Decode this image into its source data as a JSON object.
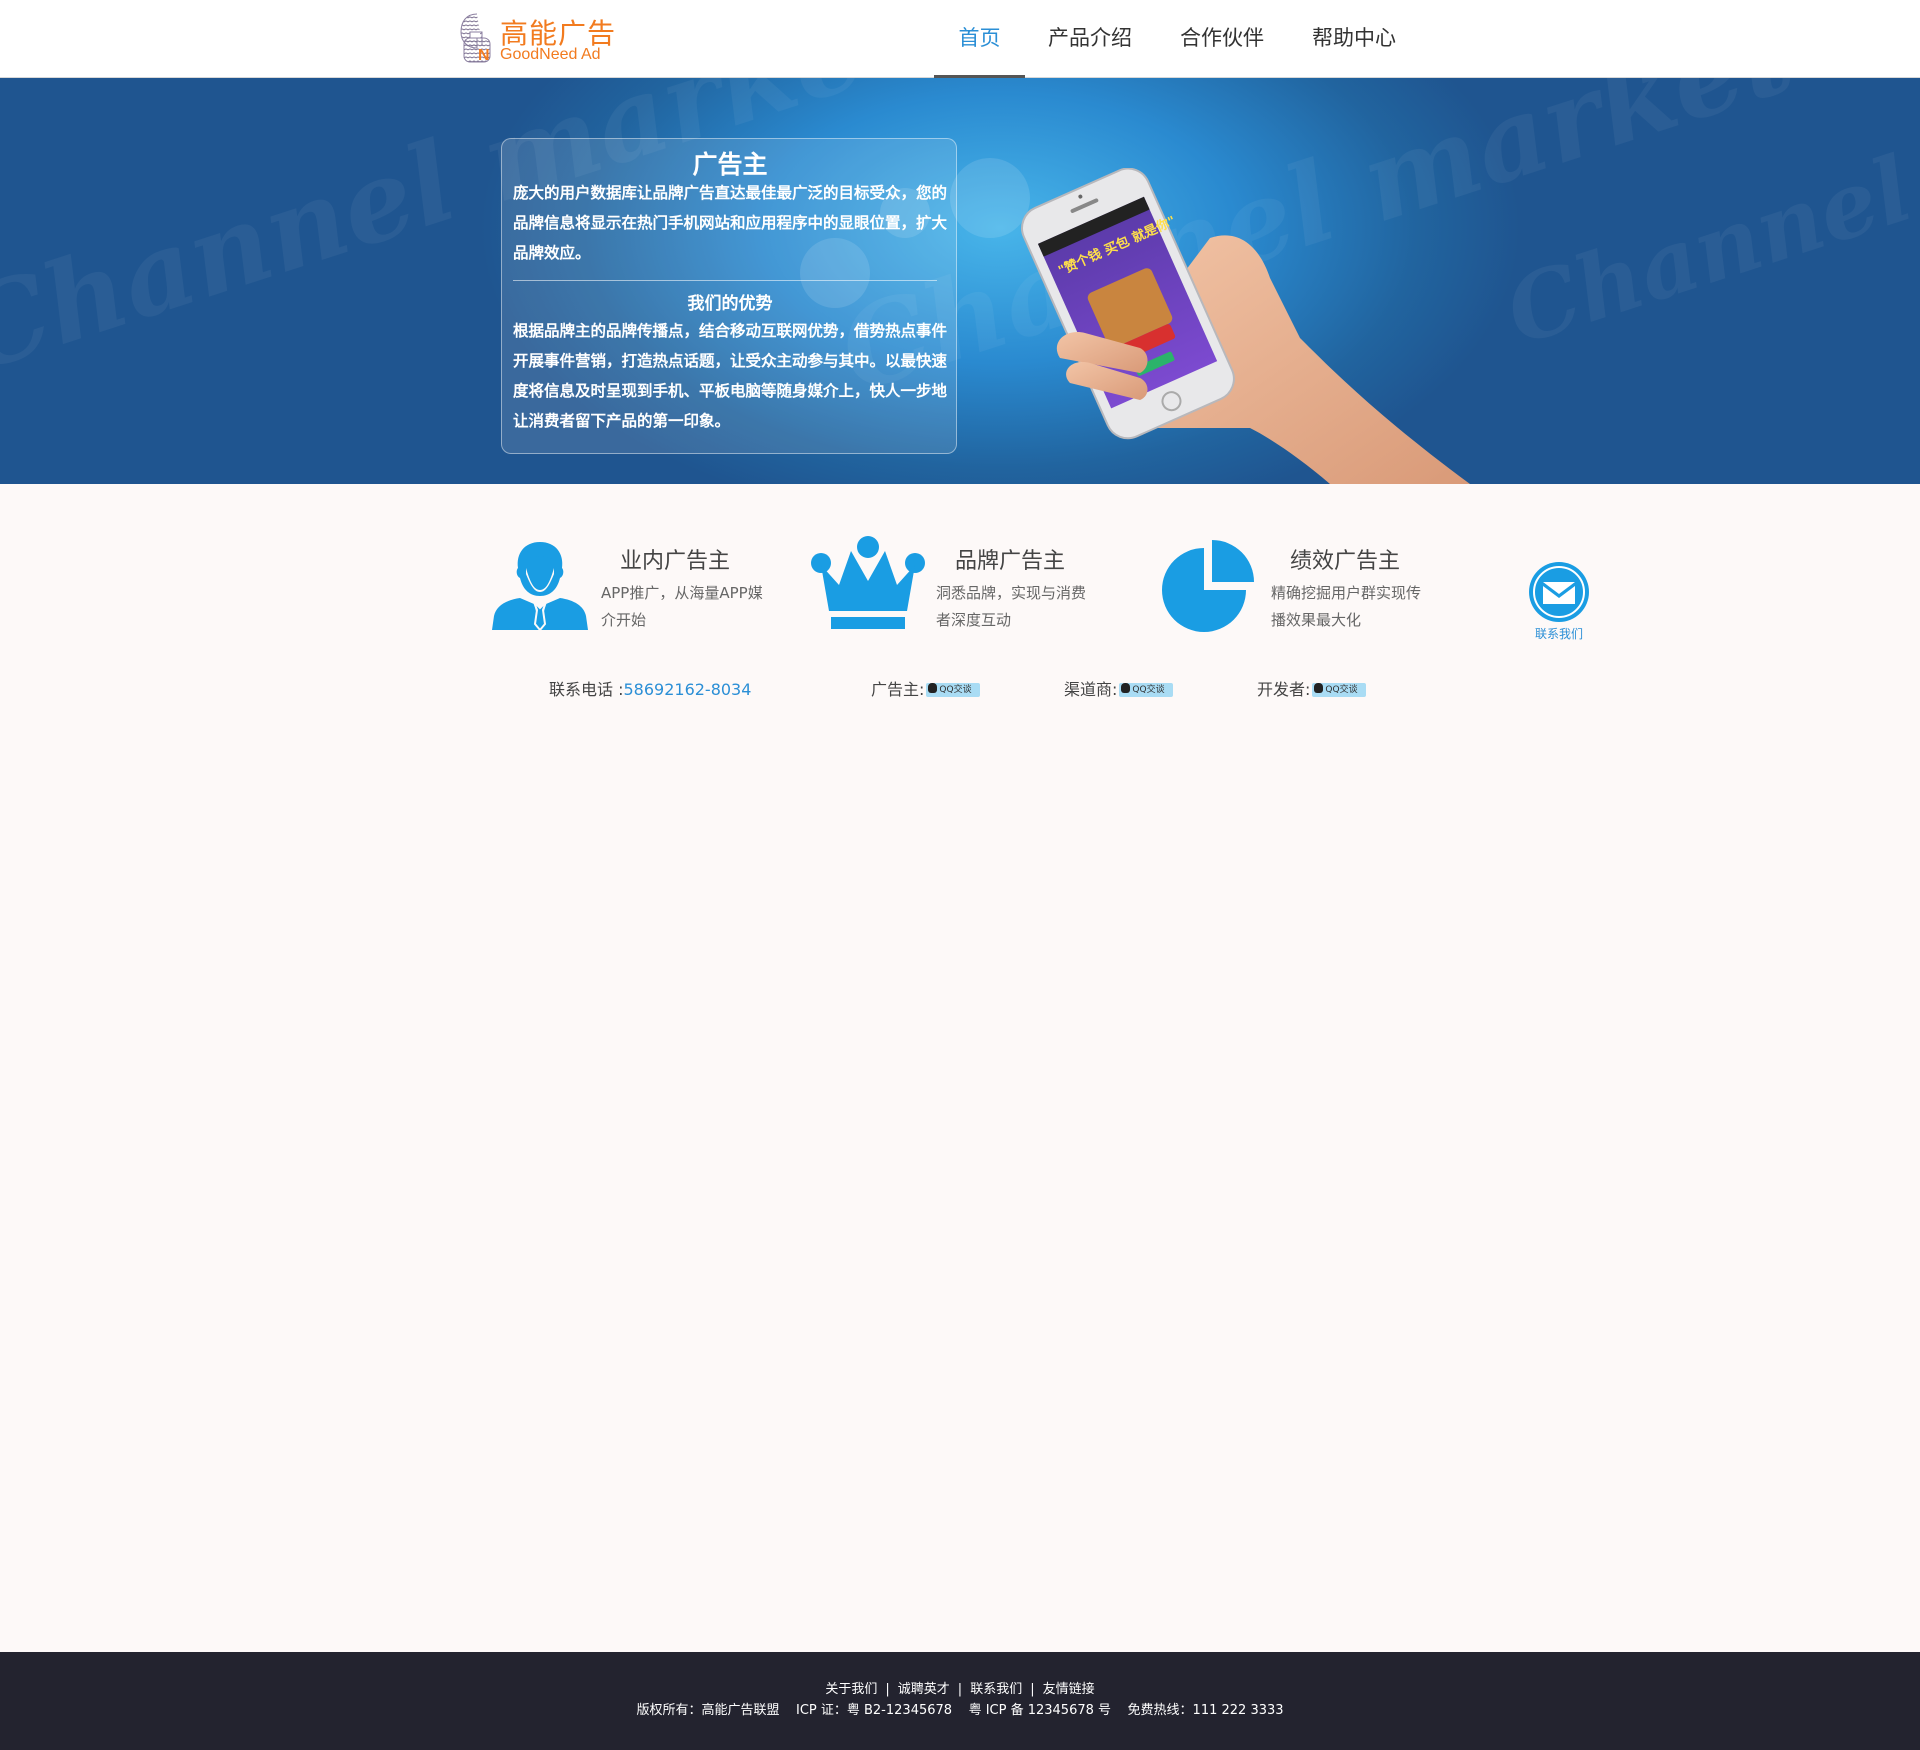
{
  "header": {
    "logo_cn": "高能广告",
    "logo_en": "GoodNeed Ad",
    "nav": [
      {
        "label": "首页",
        "active": true
      },
      {
        "label": "产品介绍",
        "active": false
      },
      {
        "label": "合作伙伴",
        "active": false
      },
      {
        "label": "帮助中心",
        "active": false
      }
    ]
  },
  "banner": {
    "title": "广告主",
    "paragraph1": "庞大的用户数据库让品牌广告直达最佳最广泛的目标受众，您的品牌信息将显示在热门手机网站和应用程序中的显眼位置，扩大品牌效应。",
    "subtitle": "我们的优势",
    "paragraph2": "根据品牌主的品牌传播点，结合移动互联网优势，借势热点事件开展事件营销，打造热点话题，让受众主动参与其中。以最快速度将信息及时呈现到手机、平板电脑等随身媒介上，快人一步地让消费者留下产品的第一印象。",
    "phone_screen_text": "\"赞个钱 买包 就是你\""
  },
  "features": [
    {
      "title": "业内广告主",
      "desc": "APP推广，从海量APP媒介开始",
      "icon": "businessman-icon"
    },
    {
      "title": "品牌广告主",
      "desc": "洞悉品牌，实现与消费者深度互动",
      "icon": "crown-icon"
    },
    {
      "title": "绩效广告主",
      "desc": "精确挖掘用户群实现传播效果最大化",
      "icon": "pie-chart-icon"
    }
  ],
  "contact_us": {
    "label": "联系我们",
    "icon": "envelope-icon"
  },
  "contacts": {
    "phone_label": "联系电话 :",
    "phone_value": "58692162-8034",
    "advertiser_label": "广告主:",
    "channel_label": "渠道商:",
    "developer_label": "开发者:",
    "qq_button": "QQ交谈"
  },
  "footer": {
    "links": [
      "关于我们",
      "诚聘英才",
      "联系我们",
      "友情链接"
    ],
    "separator": "|",
    "copyright": "版权所有：高能广告联盟    ICP 证：粤 B2-12345678    粤 ICP 备 12345678 号    免费热线：111 222 3333"
  },
  "colors": {
    "brand_orange": "#f27b1f",
    "accent_blue": "#2b8fd6",
    "icon_blue": "#1a9de3",
    "footer_bg": "#23232f",
    "page_bg": "#fdf9f8"
  }
}
